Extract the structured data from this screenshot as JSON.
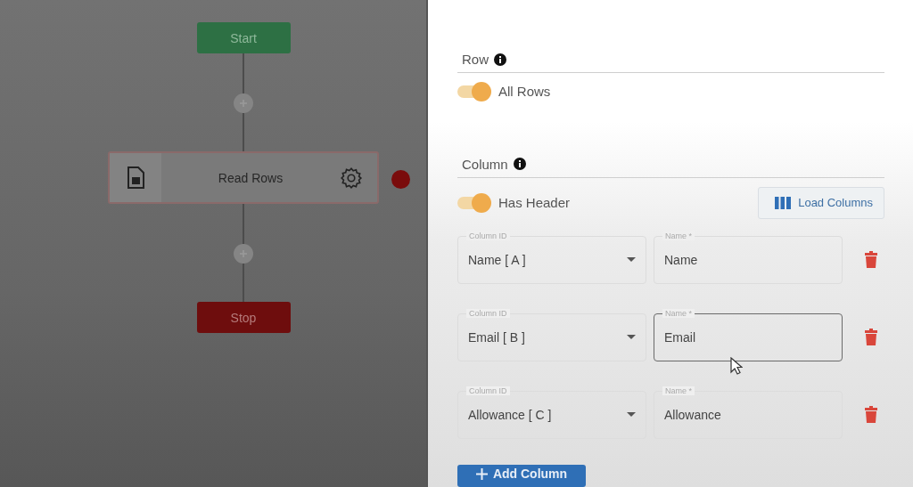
{
  "flow": {
    "nodes": [
      {
        "kind": "start",
        "label": "Start"
      },
      {
        "kind": "task",
        "label": "Read Rows",
        "error": true
      },
      {
        "kind": "stop",
        "label": "Stop"
      }
    ]
  },
  "panel": {
    "row_section": {
      "title": "Row",
      "toggle": {
        "label": "All Rows",
        "on": true
      }
    },
    "column_section": {
      "title": "Column",
      "toggle": {
        "label": "Has Header",
        "on": true
      },
      "load_button": "Load Columns"
    },
    "columns": [
      {
        "column_id_label": "Column ID",
        "column_id": "Name [ A ]",
        "name_label": "Name *",
        "name": "Name",
        "focused": false
      },
      {
        "column_id_label": "Column ID",
        "column_id": "Email [ B ]",
        "name_label": "Name *",
        "name": "Email",
        "focused": true
      },
      {
        "column_id_label": "Column ID",
        "column_id": "Allowance [ C ]",
        "name_label": "Name *",
        "name": "Allowance",
        "focused": false
      }
    ],
    "add_button": "Add Column"
  }
}
